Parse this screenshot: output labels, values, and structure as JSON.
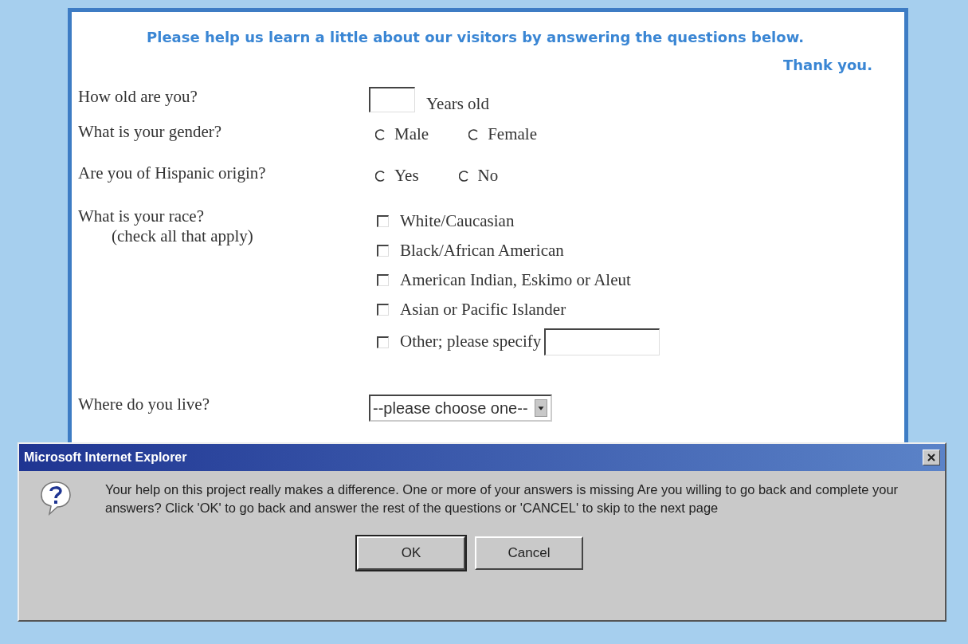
{
  "page": {
    "intro": "Please help us learn a little about our visitors by answering the questions below.",
    "thanks": "Thank you."
  },
  "questions": [
    {
      "kind": "text",
      "label": "How old are you?",
      "suffix": "Years old"
    },
    {
      "kind": "radio",
      "label": "What is your gender?",
      "options": [
        {
          "label": "Male",
          "selected": false
        },
        {
          "label": "Female",
          "selected": false
        }
      ]
    },
    {
      "kind": "radio",
      "label": "Are you of Hispanic origin?",
      "options": [
        {
          "label": "Yes",
          "selected": false
        },
        {
          "label": "No",
          "selected": false
        }
      ]
    },
    {
      "kind": "checkbox",
      "label": "What is your race?",
      "hint": "(check all that apply)",
      "options": [
        {
          "label": "White/Caucasian",
          "checked": false
        },
        {
          "label": "Black/African American",
          "checked": false
        },
        {
          "label": "American Indian, Eskimo or Aleut",
          "checked": false
        },
        {
          "label": "Asian or Pacific Islander",
          "checked": false
        },
        {
          "label": "Other; please specify",
          "checked": false,
          "has_field": true
        }
      ]
    },
    {
      "kind": "select",
      "label": "Where do you live?",
      "value": "--please choose one--"
    }
  ],
  "dialog": {
    "title": "Microsoft Internet Explorer",
    "message": "Your help on this project really makes a difference. One or more of your answers is missing Are you willing to go back and complete your answers? Click 'OK' to go back and answer the rest of the questions or 'CANCEL' to skip to the next page",
    "buttons": [
      {
        "label": "OK",
        "default": true
      },
      {
        "label": "Cancel",
        "default": false
      }
    ]
  }
}
